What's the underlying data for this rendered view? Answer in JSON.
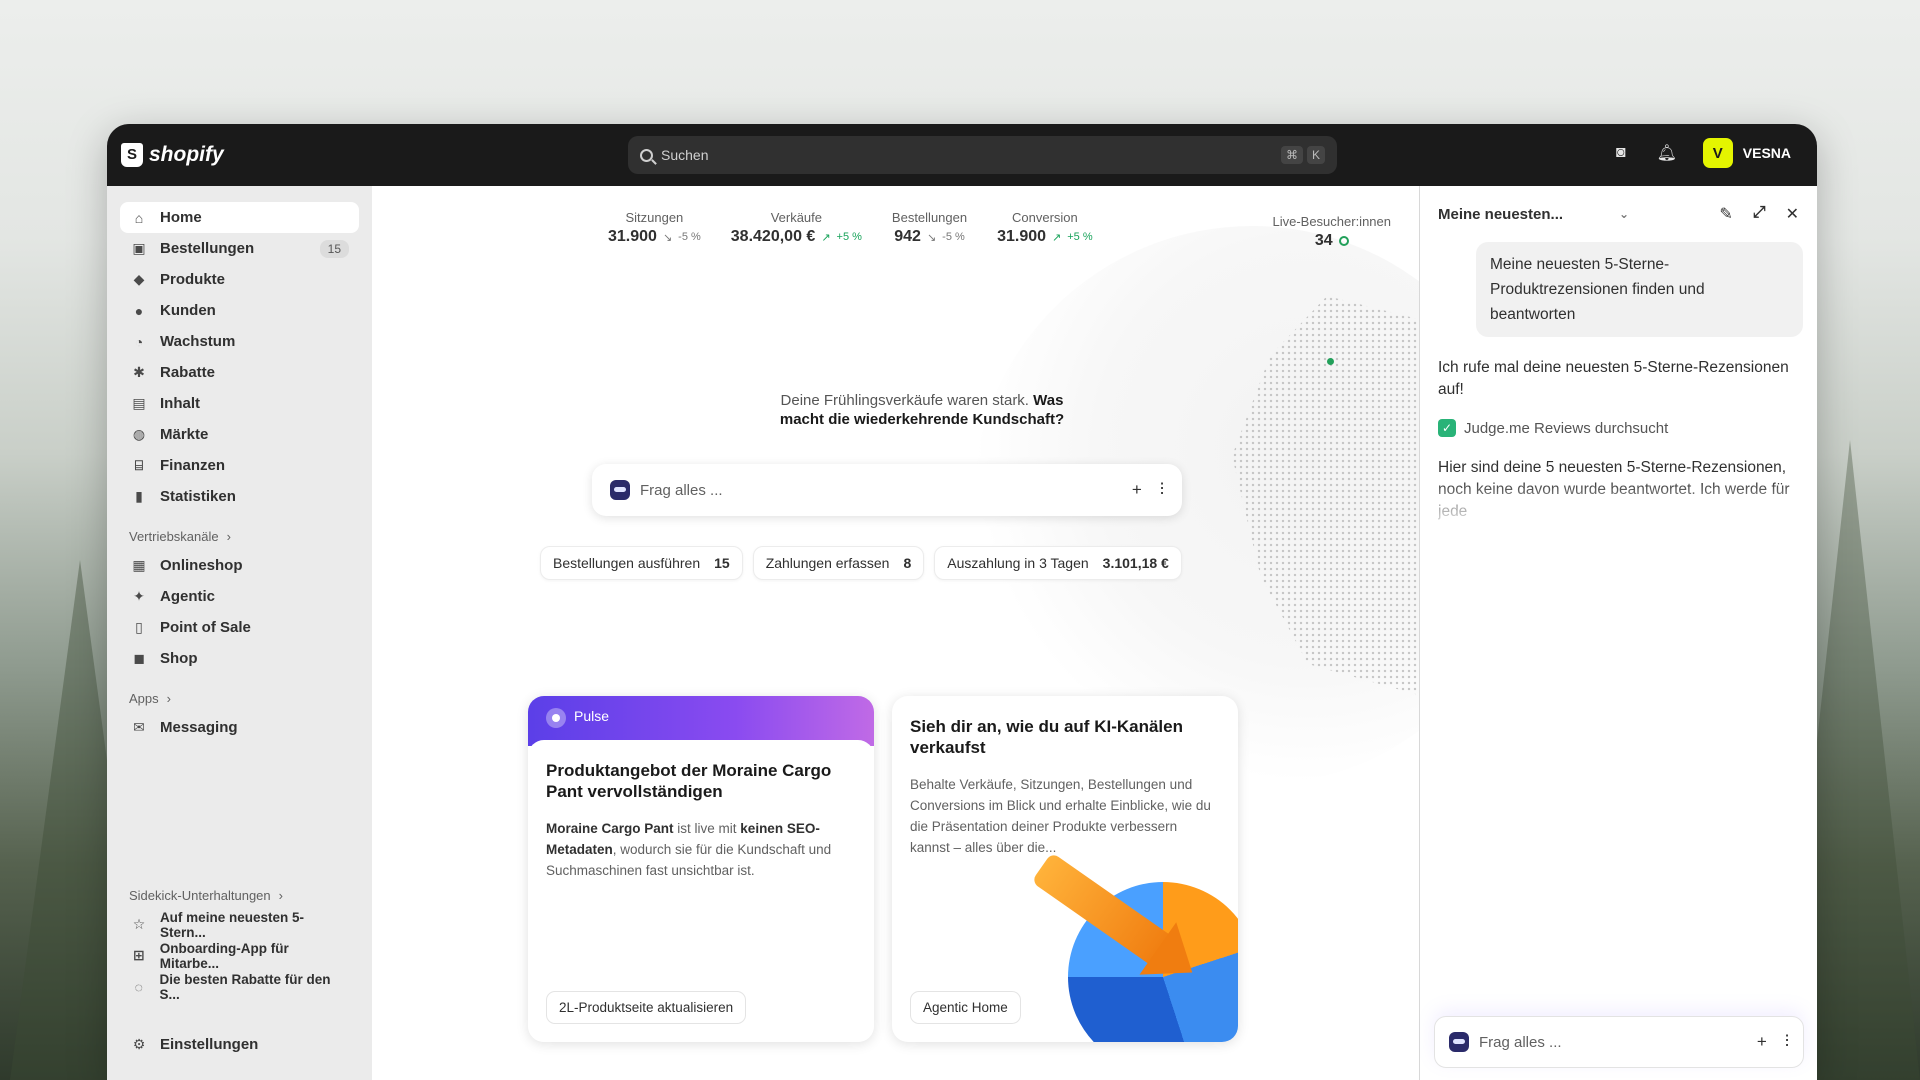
{
  "topbar": {
    "brand": "shopify",
    "search_placeholder": "Suchen",
    "shortcut_keys": [
      "⌘",
      "K"
    ],
    "account_name": "VESNA",
    "account_initial": "V"
  },
  "sidebar": {
    "items": [
      {
        "label": "Home",
        "icon": "home-icon"
      },
      {
        "label": "Bestellungen",
        "icon": "inbox-icon",
        "badge": "15"
      },
      {
        "label": "Produkte",
        "icon": "tag-icon"
      },
      {
        "label": "Kunden",
        "icon": "person-icon"
      },
      {
        "label": "Wachstum",
        "icon": "gauge-icon"
      },
      {
        "label": "Rabatte",
        "icon": "discount-icon"
      },
      {
        "label": "Inhalt",
        "icon": "content-icon"
      },
      {
        "label": "Märkte",
        "icon": "globe-icon"
      },
      {
        "label": "Finanzen",
        "icon": "bank-icon"
      },
      {
        "label": "Statistiken",
        "icon": "bar-chart-icon"
      }
    ],
    "sales_channels_heading": "Vertriebskanäle",
    "sales_channels": [
      {
        "label": "Onlineshop"
      },
      {
        "label": "Agentic"
      },
      {
        "label": "Point of Sale"
      },
      {
        "label": "Shop"
      }
    ],
    "apps_heading": "Apps",
    "apps": [
      {
        "label": "Messaging"
      }
    ],
    "sidekick_heading": "Sidekick-Unterhaltungen",
    "sidekick": [
      {
        "label": "Auf meine neuesten 5-Stern..."
      },
      {
        "label": "Onboarding-App für Mitarbe..."
      },
      {
        "label": "Die besten Rabatte für den S..."
      }
    ],
    "settings_label": "Einstellungen"
  },
  "metrics": [
    {
      "label": "Sitzungen",
      "value": "31.900",
      "trend": "-5 %",
      "direction": "down"
    },
    {
      "label": "Verkäufe",
      "value": "38.420,00 €",
      "trend": "+5 %",
      "direction": "up"
    },
    {
      "label": "Bestellungen",
      "value": "942",
      "trend": "-5 %",
      "direction": "down"
    },
    {
      "label": "Conversion",
      "value": "31.900",
      "trend": "+5 %",
      "direction": "up"
    }
  ],
  "live": {
    "label": "Live-Besucher:innen",
    "value": "34"
  },
  "prompt": {
    "normal": "Deine Frühlingsverkäufe waren stark. ",
    "bold": "Was macht die wiederkehrende Kundschaft?"
  },
  "ask_placeholder": "Frag alles ...",
  "pills": [
    {
      "label": "Bestellungen ausführen",
      "count": "15"
    },
    {
      "label": "Zahlungen erfassen",
      "count": "8"
    },
    {
      "label": "Auszahlung in 3 Tagen",
      "count": "3.101,18 €"
    }
  ],
  "card1": {
    "tag": "Pulse",
    "title": "Produktangebot der Moraine Cargo Pant vervollständigen",
    "desc_b1": "Moraine Cargo Pant",
    "desc_t1": " ist live mit ",
    "desc_b2": "keinen SEO-Metadaten",
    "desc_t2": ", wodurch sie für die Kundschaft und Suchmaschinen fast unsichtbar ist.",
    "button": "2L-Produktseite aktualisieren"
  },
  "card2": {
    "title": "Sieh dir an, wie du auf KI-Kanälen verkaufst",
    "desc": "Behalte Verkäufe, Sitzungen, Bestellungen und Conversions im Blick und erhalte Einblicke, wie du die Präsentation deiner Produkte verbessern kannst – alles über die...",
    "button": "Agentic Home"
  },
  "chat": {
    "title": "Meine neuesten...",
    "user_message": "Meine neuesten 5-Sterne-Produktrezensionen finden und beantworten",
    "assistant_1": "Ich rufe mal deine neuesten 5-Sterne-Rezensionen auf!",
    "tool": "Judge.me Reviews durchsucht",
    "assistant_2": "Hier sind deine 5 neuesten 5-Sterne-Rezensionen, noch keine davon wurde beantwortet. Ich werde für jede",
    "input_placeholder": "Frag alles ..."
  },
  "colors": {
    "accent": "#5b3fe8",
    "positive": "#18a35a",
    "topbar": "#1a1a1a",
    "avatar": "#e4f500"
  }
}
